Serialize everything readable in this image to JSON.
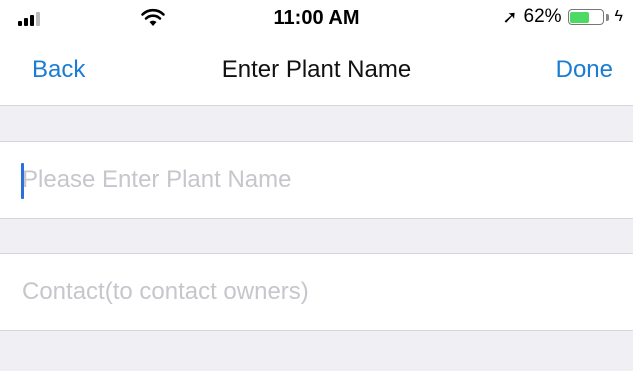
{
  "status_bar": {
    "time": "11:00 AM",
    "battery_percent": "62%",
    "battery_level": 0.62,
    "battery_color": "#4cd964",
    "icons": [
      "signal-icon",
      "wifi-icon",
      "location-arrow-icon",
      "battery-icon",
      "charging-bolt-icon"
    ]
  },
  "nav": {
    "back_label": "Back",
    "title": "Enter Plant Name",
    "done_label": "Done",
    "accent_color": "#1a7cd2"
  },
  "form": {
    "plant_name": {
      "value": "",
      "placeholder": "Please Enter Plant Name"
    },
    "contact": {
      "value": "",
      "placeholder": "Contact(to contact owners)"
    }
  }
}
